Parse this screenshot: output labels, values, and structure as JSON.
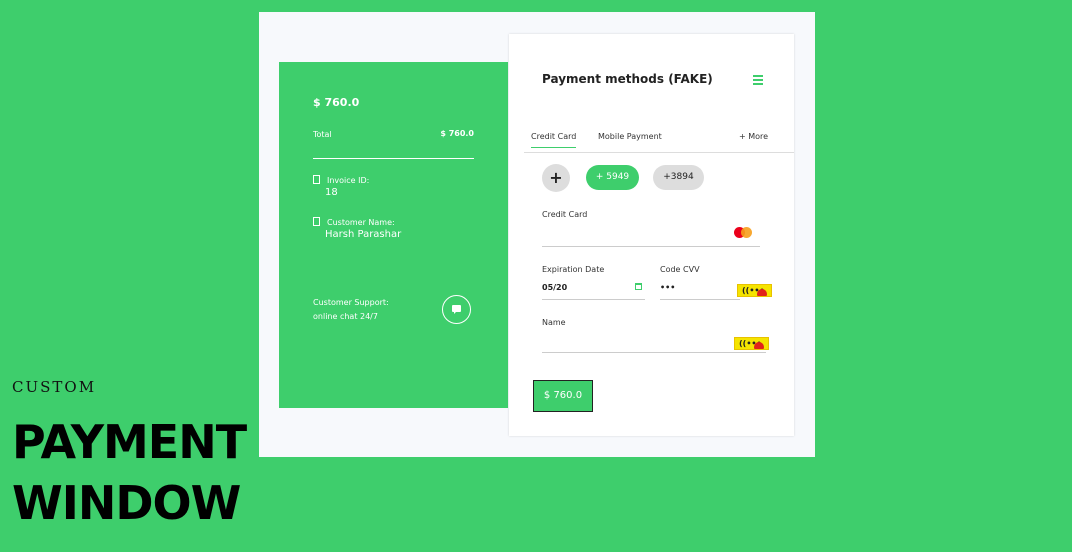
{
  "summary": {
    "amount": "$ 760.0",
    "total_label": "Total",
    "total_value": "$ 760.0",
    "invoice_label": "Invoice ID:",
    "invoice_value": "18",
    "customer_label": "Customer Name:",
    "customer_value": "Harsh Parashar",
    "support_line1": "Customer Support:",
    "support_line2": "online chat 24/7"
  },
  "panel": {
    "title": "Payment methods (FAKE)",
    "tabs": [
      "Credit Card",
      "Mobile Payment",
      "+ More"
    ],
    "chips": [
      "+",
      "+ 5949",
      "+3894"
    ],
    "credit_card_label": "Credit Card",
    "expiration_label": "Expiration Date",
    "expiration_value": "05/20",
    "cvv_label": "Code CVV",
    "cvv_value": "•••",
    "name_label": "Name",
    "pay_button": "$ 760.0"
  },
  "hero": {
    "small": "CUSTOM",
    "line1": "PAYMENT",
    "line2": "WINDOW"
  },
  "colors": {
    "accent": "#3ece6c",
    "panel_bg": "#ffffff",
    "frame_bg": "#f7f9fc"
  }
}
